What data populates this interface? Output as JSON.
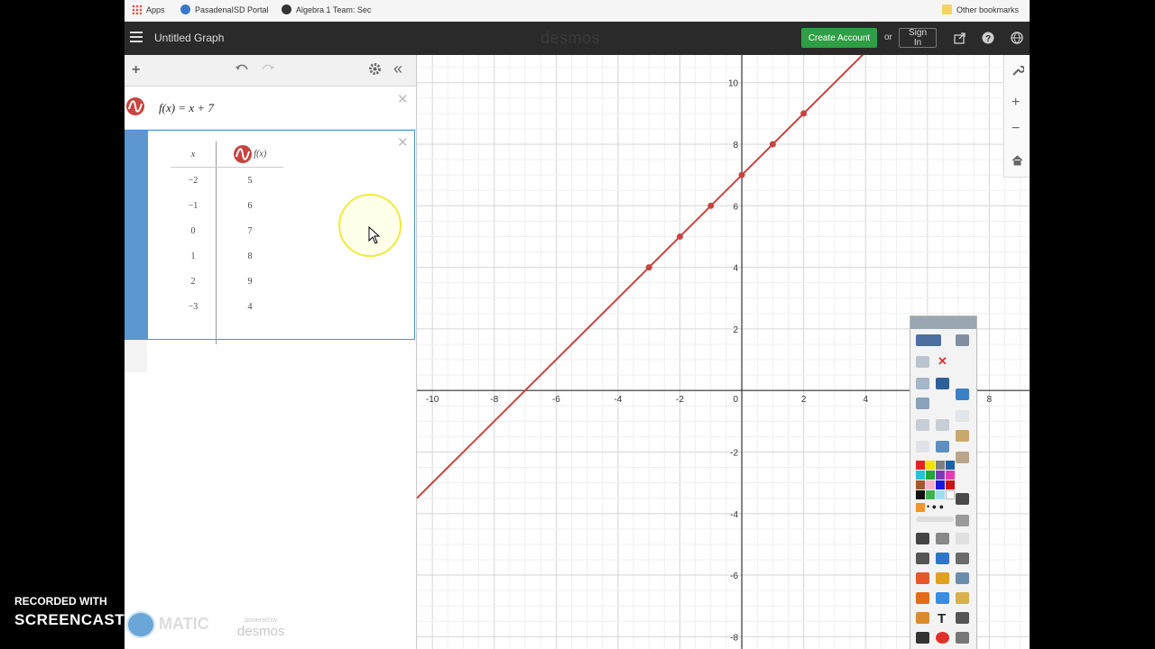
{
  "bookmarks": {
    "apps": "Apps",
    "items": [
      "PasadenaISD Portal",
      "Algebra 1 Team: Sec"
    ],
    "other": "Other bookmarks"
  },
  "topbar": {
    "title": "Untitled Graph",
    "logo": "desmos",
    "create_account": "Create Account",
    "or": "or",
    "sign_in": "Sign In"
  },
  "expressions": {
    "first": "f(x) = x + 7",
    "table": {
      "header_x": "x",
      "header_fx": "f(x)",
      "rows": [
        {
          "x": "−2",
          "fx": "5"
        },
        {
          "x": "−1",
          "fx": "6"
        },
        {
          "x": "0",
          "fx": "7"
        },
        {
          "x": "1",
          "fx": "8"
        },
        {
          "x": "2",
          "fx": "9"
        },
        {
          "x": "−3",
          "fx": "4"
        }
      ]
    }
  },
  "powered": {
    "line1": "powered by",
    "line2": "desmos"
  },
  "graph": {
    "line_color": "#c74440",
    "slope": 1,
    "intercept": 7,
    "points": [
      [
        -3,
        4
      ],
      [
        -2,
        5
      ],
      [
        -1,
        6
      ],
      [
        0,
        7
      ],
      [
        1,
        8
      ],
      [
        2,
        9
      ]
    ],
    "x_range": [
      -10.5,
      9.3
    ],
    "y_range": [
      -8.4,
      10.9
    ],
    "x_ticks": [
      "-10",
      "-8",
      "-6",
      "-4",
      "-2",
      "2",
      "4",
      "8"
    ],
    "y_ticks": [
      "10",
      "8",
      "6",
      "4",
      "2",
      "-2",
      "-4",
      "-6",
      "-8"
    ],
    "origin_label": "0"
  },
  "recorder": {
    "line1": "RECORDED WITH",
    "line2": "SCREENCAST",
    "brand": "MATIC"
  }
}
